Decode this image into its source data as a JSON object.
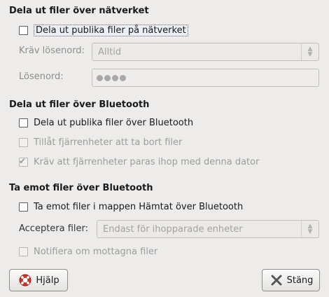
{
  "network": {
    "title": "Dela ut filer över nätverket",
    "share_label": "Dela ut publika filer på nätverket",
    "share_checked": false,
    "password_required_label": "Kräv lösenord:",
    "password_required_value": "Alltid",
    "password_label": "Lösenord:"
  },
  "bluetooth_share": {
    "title": "Dela ut filer över Bluetooth",
    "share_label": "Dela ut publika filer över Bluetooth",
    "share_checked": false,
    "allow_delete_label": "Tillåt fjärrenheter att ta bort filer",
    "allow_delete_checked": false,
    "require_pairing_label": "Kräv att fjärrenheter paras ihop med denna dator",
    "require_pairing_checked": true
  },
  "bluetooth_receive": {
    "title": "Ta emot filer över Bluetooth",
    "receive_label": "Ta emot filer i mappen Hämtat över Bluetooth",
    "receive_checked": false,
    "accept_label": "Acceptera filer:",
    "accept_value": "Endast för ihopparade enheter",
    "notify_label": "Notifiera om mottagna filer",
    "notify_checked": false
  },
  "buttons": {
    "help_label": "Hjälp",
    "close_label": "Stäng"
  },
  "icons": {
    "help": "lifebuoy-icon",
    "close": "close-x-icon"
  },
  "colors": {
    "window_bg": "#edeceb",
    "focus_bg": "#eaeff6",
    "lifebuoy_red": "#d8342c"
  }
}
